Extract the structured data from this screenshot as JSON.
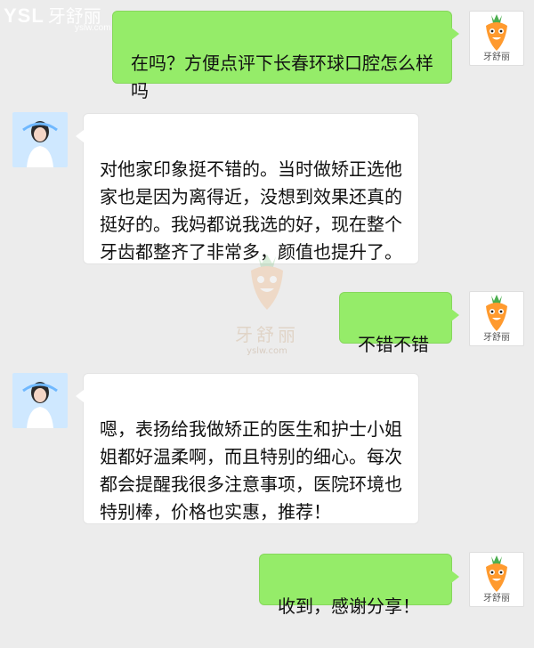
{
  "watermark": {
    "brand_prefix": "YSL",
    "brand_name": "牙舒丽",
    "url": "yslw.com"
  },
  "carrot_avatar_label": "牙舒丽",
  "messages": [
    {
      "side": "out",
      "text": "在吗？方便点评下长春环球口腔怎么样吗"
    },
    {
      "side": "in",
      "text": "对他家印象挺不错的。当时做矫正选他家也是因为离得近，没想到效果还真的挺好的。我妈都说我选的好，现在整个牙齿都整齐了非常多，颜值也提升了。"
    },
    {
      "side": "out",
      "text": "不错不错"
    },
    {
      "side": "in",
      "text": "嗯，表扬给我做矫正的医生和护士小姐姐都好温柔啊，而且特别的细心。每次都会提醒我很多注意事项，医院环境也特别棒，价格也实惠，推荐！"
    },
    {
      "side": "out",
      "text": "收到，感谢分享！"
    }
  ],
  "colors": {
    "background": "#ececec",
    "outgoing_bubble": "#95ec69",
    "incoming_bubble": "#ffffff"
  }
}
